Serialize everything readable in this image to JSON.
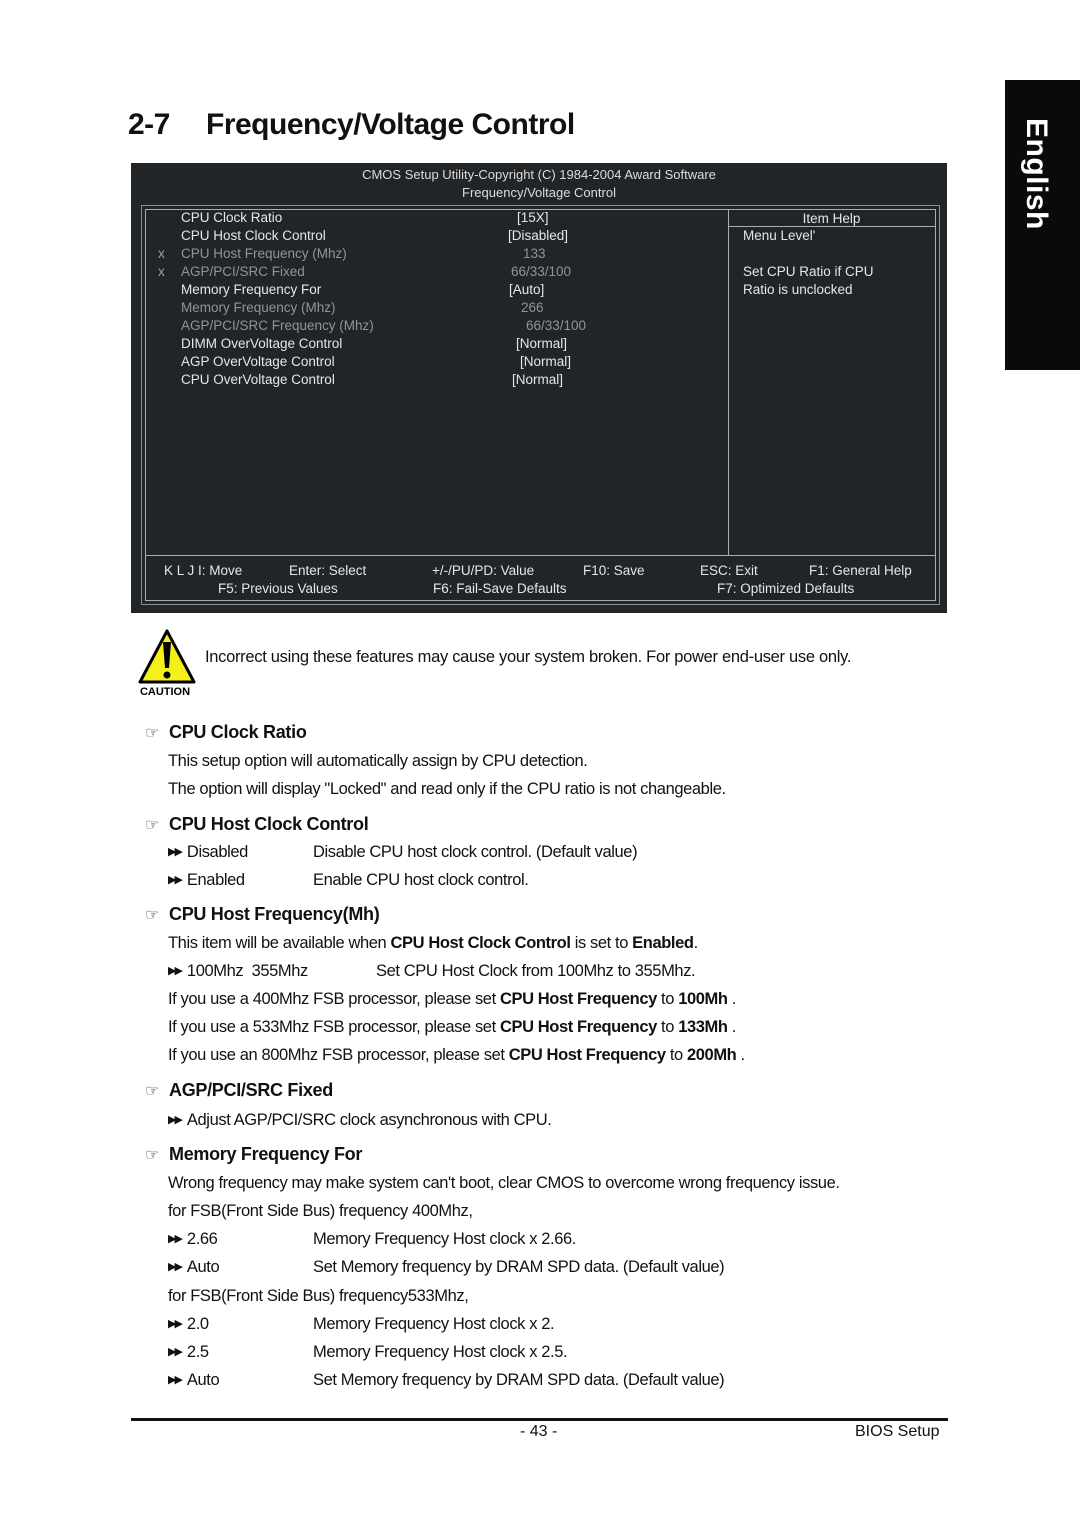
{
  "side_tab": {
    "label": "English"
  },
  "heading": {
    "number": "2-7",
    "title": "Frequency/Voltage Control"
  },
  "bios": {
    "header_line1": "CMOS Setup Utility-Copyright (C) 1984-2004 Award Software",
    "header_line2": "Frequency/Voltage Control",
    "items": [
      {
        "marker": "",
        "label": "CPU Clock Ratio",
        "value": "[15X]",
        "disabled": false
      },
      {
        "marker": "",
        "label": "CPU Host Clock Control",
        "value": "[Disabled]",
        "disabled": false
      },
      {
        "marker": "x",
        "label": "CPU Host Frequency (Mhz)",
        "value": "133",
        "disabled": true
      },
      {
        "marker": "x",
        "label": "AGP/PCI/SRC Fixed",
        "value": "66/33/100",
        "disabled": true
      },
      {
        "marker": "",
        "label": "Memory Frequency For",
        "value": "[Auto]",
        "disabled": false
      },
      {
        "marker": "",
        "label": "Memory Frequency (Mhz)",
        "value": "266",
        "disabled": true
      },
      {
        "marker": "",
        "label": "AGP/PCI/SRC Frequency (Mhz)",
        "value": "66/33/100",
        "disabled": true
      },
      {
        "marker": "",
        "label": "DIMM OverVoltage Control",
        "value": "[Normal]",
        "disabled": false
      },
      {
        "marker": "",
        "label": "AGP OverVoltage Control",
        "value": "[Normal]",
        "disabled": false
      },
      {
        "marker": "",
        "label": "CPU OverVoltage Control",
        "value": "[Normal]",
        "disabled": false
      }
    ],
    "help_title": "Item Help",
    "help_lines": [
      "Menu Level'",
      "",
      "Set CPU Ratio if CPU",
      "Ratio is unclocked"
    ],
    "keys_row1": [
      "K L J I: Move",
      "Enter: Select",
      "+/-/PU/PD: Value",
      "F10: Save",
      "ESC: Exit",
      "F1: General Help"
    ],
    "keys_row2": [
      "F5: Previous Values",
      "F6: Fail-Save Defaults",
      "F7: Optimized Defaults"
    ]
  },
  "caution": {
    "label": "CAUTION",
    "text": "Incorrect using these features may cause your system broken. For power end-user use only."
  },
  "sections": {
    "cpu_clock_ratio": {
      "title": "CPU Clock Ratio",
      "lines": [
        "This setup option will automatically assign by CPU detection.",
        "The option will display \"Locked\" and read only if the CPU ratio is not changeable."
      ]
    },
    "cpu_host_clock_control": {
      "title": "CPU Host Clock Control",
      "options": [
        {
          "key": "Disabled",
          "desc": "Disable CPU host clock control. (Default value)"
        },
        {
          "key": "Enabled",
          "desc": "Enable CPU host clock control."
        }
      ]
    },
    "cpu_host_frequency": {
      "title": "CPU Host Frequency(Mh)",
      "avail_pre": "This item will be available when ",
      "avail_bold1": "CPU Host Clock Control",
      "avail_mid": " is set to ",
      "avail_bold2": "Enabled",
      "avail_post": ".",
      "option": {
        "key": "100Mhz  355Mhz",
        "desc": "Set CPU Host Clock from 100Mhz to 355Mhz."
      },
      "fsb_lines": [
        {
          "pre": "If you use a 400Mhz FSB processor, please set ",
          "bold": "CPU Host Frequency",
          "mid": " to ",
          "val": "100Mh",
          "post": " ."
        },
        {
          "pre": "If you use a 533Mhz FSB processor, please set ",
          "bold": "CPU Host Frequency",
          "mid": " to ",
          "val": "133Mh",
          "post": " ."
        },
        {
          "pre": "If you use an 800Mhz FSB processor, please set ",
          "bold": "CPU Host Frequency",
          "mid": " to ",
          "val": "200Mh",
          "post": " ."
        }
      ]
    },
    "agp_pci_src_fixed": {
      "title": "AGP/PCI/SRC Fixed",
      "option": "Adjust AGP/PCI/SRC clock asynchronous with CPU."
    },
    "memory_frequency_for": {
      "title": "Memory Frequency For",
      "intro": "Wrong frequency may make system can't boot, clear CMOS to overcome wrong frequency issue.",
      "fsb400": "for FSB(Front Side Bus) frequency 400Mhz,",
      "options400": [
        {
          "key": "2.66",
          "desc": "Memory Frequency  Host clock x 2.66."
        },
        {
          "key": "Auto",
          "desc": "Set Memory frequency by DRAM SPD data. (Default value)"
        }
      ],
      "fsb533": "for FSB(Front Side Bus) frequency533Mhz,",
      "options533": [
        {
          "key": "2.0",
          "desc": "Memory Frequency  Host clock x 2."
        },
        {
          "key": "2.5",
          "desc": "Memory Frequency  Host clock x 2.5."
        },
        {
          "key": "Auto",
          "desc": "Set Memory frequency by DRAM SPD data. (Default value)"
        }
      ]
    }
  },
  "footer": {
    "page": "- 43 -",
    "title": "BIOS Setup"
  }
}
